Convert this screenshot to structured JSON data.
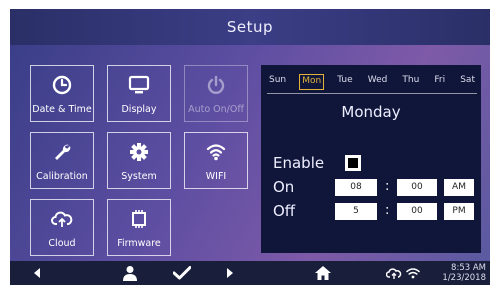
{
  "title": "Setup",
  "tiles": [
    {
      "label": "Date & Time",
      "icon": "clock-icon",
      "enabled": true
    },
    {
      "label": "Display",
      "icon": "monitor-icon",
      "enabled": true
    },
    {
      "label": "Auto On/Off",
      "icon": "power-icon",
      "enabled": false
    },
    {
      "label": "Calibration",
      "icon": "wrench-icon",
      "enabled": true
    },
    {
      "label": "System",
      "icon": "gear-icon",
      "enabled": true
    },
    {
      "label": "WIFI",
      "icon": "wifi-icon",
      "enabled": true
    },
    {
      "label": "Cloud",
      "icon": "cloud-sync-icon",
      "enabled": true
    },
    {
      "label": "Firmware",
      "icon": "chip-icon",
      "enabled": true
    }
  ],
  "schedule": {
    "days": [
      "Sun",
      "Mon",
      "Tue",
      "Wed",
      "Thu",
      "Fri",
      "Sat"
    ],
    "selected_day": "Mon",
    "day_name": "Monday",
    "enable_label": "Enable",
    "enabled": true,
    "on": {
      "label": "On",
      "hour": "08",
      "minute": "00",
      "ampm": "AM"
    },
    "off": {
      "label": "Off",
      "hour": "5",
      "minute": "00",
      "ampm": "PM"
    },
    "separator": ":"
  },
  "bottom": {
    "time": "8:53 AM",
    "date": "1/23/2018",
    "icons": [
      "back-icon",
      "user-icon",
      "check-icon",
      "forward-icon",
      "home-icon",
      "cloud-sync-icon",
      "wifi-icon"
    ]
  },
  "colors": {
    "accent": "#e1b33a",
    "panel": "#10163a",
    "bar": "#191e3a"
  }
}
